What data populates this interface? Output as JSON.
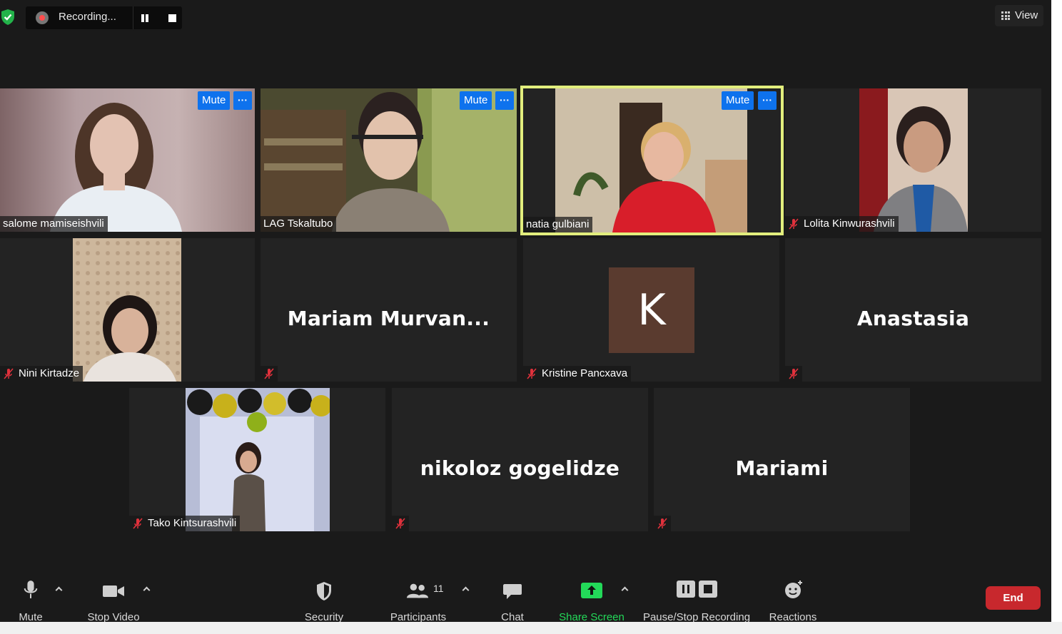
{
  "top_bar": {
    "recording_label": "Recording...",
    "view_label": "View"
  },
  "tiles": {
    "t1": {
      "name": "salome mamiseishvili",
      "mute_label": "Mute",
      "more_label": "···"
    },
    "t2": {
      "name": "LAG Tskaltubo",
      "mute_label": "Mute",
      "more_label": "···"
    },
    "t3": {
      "name": "natia gulbiani",
      "mute_label": "Mute",
      "more_label": "···"
    },
    "t4": {
      "name": "Lolita Kinwurashvili"
    },
    "t5": {
      "name": "Nini Kirtadze"
    },
    "t6": {
      "display_name": "Mariam  Murvan..."
    },
    "t7": {
      "name": "Kristine Pancxava",
      "avatar_letter": "K"
    },
    "t8": {
      "display_name": "Anastasia"
    },
    "t9": {
      "name": "Tako Kintsurashvili"
    },
    "t10": {
      "display_name": "nikoloz gogelidze"
    },
    "t11": {
      "display_name": "Mariami"
    }
  },
  "toolbar": {
    "mute": "Mute",
    "stop_video": "Stop Video",
    "security": "Security",
    "participants": "Participants",
    "participants_count": "11",
    "chat": "Chat",
    "share_screen": "Share Screen",
    "recording": "Pause/Stop Recording",
    "reactions": "Reactions",
    "end": "End"
  },
  "colors": {
    "active_speaker_border": "#e2ee7d",
    "mute_button": "#0e72ed",
    "share_screen": "#23d959",
    "end_button": "#c8282d",
    "muted_mic": "#e0313c"
  }
}
